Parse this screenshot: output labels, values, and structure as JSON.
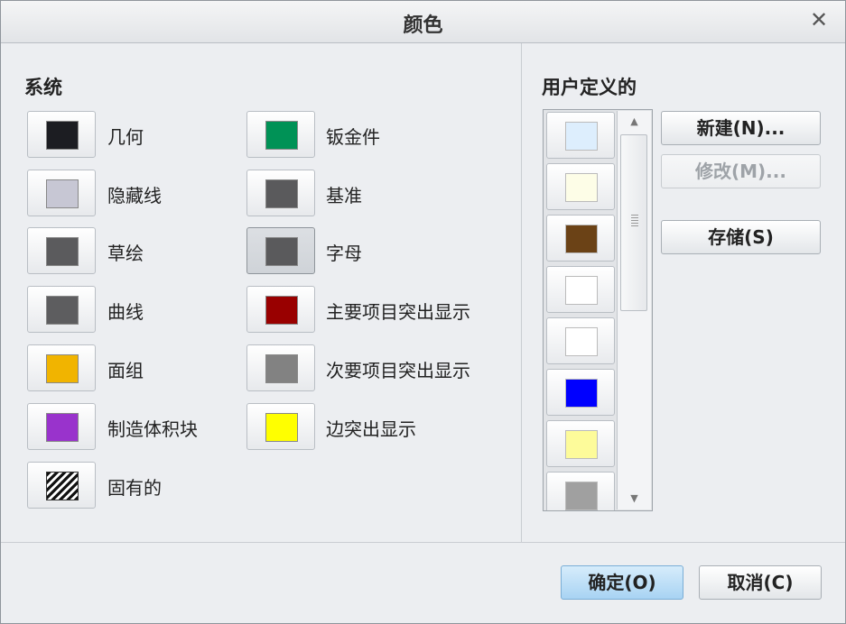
{
  "window": {
    "title": "颜色"
  },
  "system": {
    "label": "系统",
    "colors": [
      {
        "label": "几何",
        "color": "#1c1d22"
      },
      {
        "label": "隐藏线",
        "color": "#c7c7d4"
      },
      {
        "label": "草绘",
        "color": "#5b5b5d"
      },
      {
        "label": "曲线",
        "color": "#5d5d5f"
      },
      {
        "label": "面组",
        "color": "#f1b400"
      },
      {
        "label": "制造体积块",
        "color": "#9933cc"
      },
      {
        "label": "固有的",
        "color": "hatch"
      },
      {
        "label": "钣金件",
        "color": "#009256"
      },
      {
        "label": "基准",
        "color": "#5a5a5c"
      },
      {
        "label": "字母",
        "color": "#5a5a5c",
        "pressed": true
      },
      {
        "label": "主要项目突出显示",
        "color": "#990000"
      },
      {
        "label": "次要项目突出显示",
        "color": "#828282"
      },
      {
        "label": "边突出显示",
        "color": "#ffff00"
      }
    ]
  },
  "user_defined": {
    "label": "用户定义的",
    "colors": [
      "#ddeefd",
      "#fdfde7",
      "#6b4216",
      "#ffffff",
      "#ffffff",
      "#0000ff",
      "#fdfb9a",
      "#a0a0a0"
    ]
  },
  "buttons": {
    "new": "新建(N)...",
    "modify": "修改(M)...",
    "save": "存储(S)",
    "ok": "确定(O)",
    "cancel": "取消(C)"
  },
  "icons": {
    "close": "close-icon",
    "scroll_up": "arrow-up-icon",
    "scroll_down": "arrow-down-icon"
  }
}
